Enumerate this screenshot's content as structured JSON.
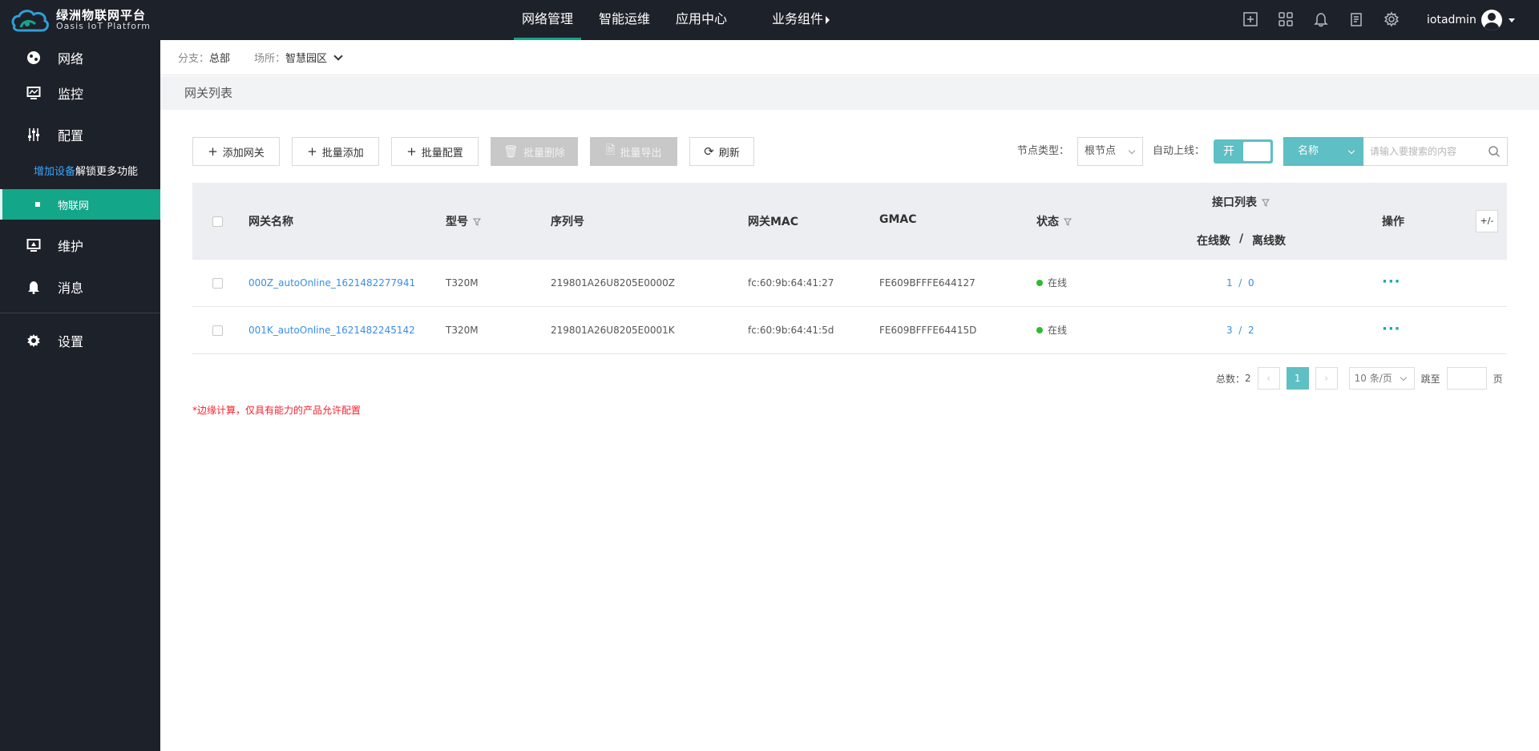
{
  "header": {
    "logo_cn": "绿洲物联网平台",
    "logo_en": "Oasis IoT Platform",
    "nav": [
      "网络管理",
      "智能运维",
      "应用中心",
      "业务组件"
    ],
    "active_nav": "网络管理",
    "icons": [
      "plus-square-icon",
      "apps-grid-icon",
      "bell-icon",
      "document-icon",
      "gear-icon"
    ],
    "username": "iotadmin"
  },
  "sidebar": {
    "items": [
      {
        "label": "网络",
        "icon": "globe-icon"
      },
      {
        "label": "监控",
        "icon": "monitor-icon"
      },
      {
        "label": "配置",
        "icon": "sliders-icon"
      },
      {
        "label": "维护",
        "icon": "maintenance-icon"
      },
      {
        "label": "消息",
        "icon": "bell-icon"
      },
      {
        "label": "设置",
        "icon": "gear-icon"
      }
    ],
    "promo_highlight": "增加设备",
    "promo_rest": "解锁更多功能",
    "active_sub": "物联网"
  },
  "breadcrumb": {
    "branch_label": "分支：",
    "branch_value": "总部",
    "site_label": "场所：",
    "site_value": "智慧园区"
  },
  "page_title": "网关列表",
  "toolbar": {
    "add": "添加网关",
    "batch_add": "批量添加",
    "batch_config": "批量配置",
    "batch_delete": "批量删除",
    "batch_export": "批量导出",
    "refresh": "刷新",
    "node_type_label": "节点类型：",
    "node_type_value": "根节点",
    "auto_online_label": "自动上线：",
    "toggle_on": "开",
    "search_category": "名称",
    "search_placeholder": "请输入要搜索的内容"
  },
  "table": {
    "headers": {
      "name": "网关名称",
      "model": "型号",
      "serial": "序列号",
      "mac": "网关MAC",
      "gmac": "GMAC",
      "status": "状态",
      "ports": "接口列表",
      "online": "在线数",
      "sep": "/",
      "offline": "离线数",
      "ops": "操作",
      "toggle_cols": "+/-"
    },
    "rows": [
      {
        "name": "000Z_autoOnline_1621482277941",
        "model": "T320M",
        "serial": "219801A26U8205E0000Z",
        "mac": "fc:60:9b:64:41:27",
        "gmac": "FE609BFFFE644127",
        "status": "在线",
        "online": "1",
        "sep": "/",
        "offline": "0",
        "ops": "···"
      },
      {
        "name": "001K_autoOnline_1621482245142",
        "model": "T320M",
        "serial": "219801A26U8205E0001K",
        "mac": "fc:60:9b:64:41:5d",
        "gmac": "FE609BFFFE64415D",
        "status": "在线",
        "online": "3",
        "sep": "/",
        "offline": "2",
        "ops": "···"
      }
    ]
  },
  "pagination": {
    "total_label": "总数：",
    "total": "2",
    "prev": "‹",
    "current": "1",
    "next": "›",
    "page_size": "10 条/页",
    "jump_label": "跳至",
    "page_unit": "页"
  },
  "note": "*边缘计算，仅具有能力的产品允许配置",
  "colors": {
    "sidebar_bg": "#1d2129",
    "accent_green": "#13a689",
    "accent_teal": "#5ebfc4",
    "link_blue": "#3a8ee6",
    "status_online": "#2bbd2b",
    "note_red": "#f5222d"
  }
}
